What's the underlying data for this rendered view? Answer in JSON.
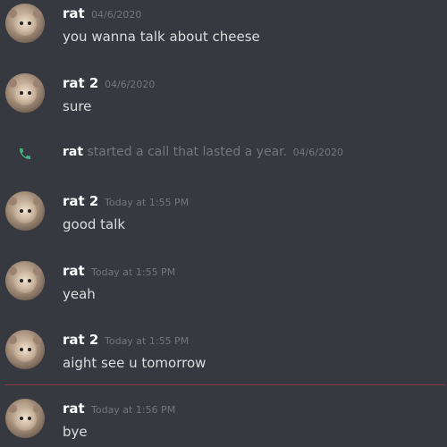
{
  "messages": [
    {
      "author": "rat",
      "timestamp": "04/6/2020",
      "text": "you wanna talk about cheese"
    },
    {
      "author": "rat 2",
      "timestamp": "04/6/2020",
      "text": "sure"
    },
    {
      "author": "rat 2",
      "timestamp": "Today at 1:55 PM",
      "text": "good talk"
    },
    {
      "author": "rat",
      "timestamp": "Today at 1:55 PM",
      "text": "yeah"
    },
    {
      "author": "rat 2",
      "timestamp": "Today at 1:55 PM",
      "text": "aight see u tomorrow"
    },
    {
      "author": "rat",
      "timestamp": "Today at 1:56 PM",
      "text": "bye"
    }
  ],
  "call": {
    "icon": "phone-icon",
    "author": "rat",
    "text": "started a call that lasted a year.",
    "timestamp": "04/6/2020"
  },
  "colors": {
    "background": "#36393f",
    "username": "#ffffff",
    "message_text": "#dcddde",
    "timestamp": "#72767d",
    "call_icon": "#43b581",
    "new_messages_divider": "#8b3a3e"
  }
}
